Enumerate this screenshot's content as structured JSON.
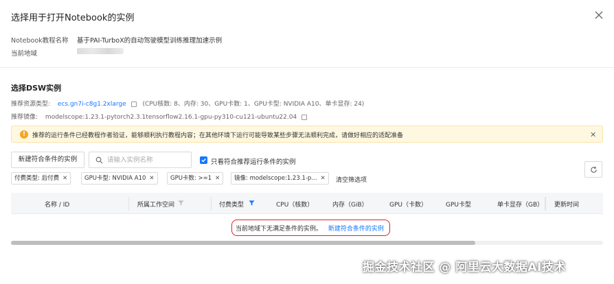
{
  "dialog": {
    "title": "选择用于打开Notebook的实例",
    "info": {
      "notebook_name_label": "Notebook教程名称",
      "notebook_name_value": "基于PAI-TurboX的自动驾驶模型训练推理加速示例",
      "region_label": "当前地域"
    }
  },
  "dsw": {
    "section_title": "选择DSW实例",
    "spec_label": "推荐资源类型:",
    "spec_value": "ecs.gn7i-c8g1.2xlarge",
    "spec_detail": "(CPU核数: 8、内存: 30、GPU卡数: 1、GPU卡型: NVIDIA A10、单卡显存: 24)",
    "image_label": "推荐镜像:",
    "image_value": "modelscope:1.23.1-pytorch2.3.1tensorflow2.16.1-gpu-py310-cu121-ubuntu22.04"
  },
  "alert": {
    "icon": "warning-icon",
    "text": "推荐的运行条件已经教程作者验证，能够顺利执行教程内容；在其他环境下运行可能导致某些步骤无法顺利完成，请做好相应的适配准备"
  },
  "toolbar": {
    "create_button": "新建符合条件的实例",
    "search_placeholder": "请输入实例名称",
    "only_matching_label": "只看符合推荐运行条件的实例",
    "only_matching_checked": true
  },
  "filters": {
    "tags": [
      "付费类型: 后付费",
      "GPU卡型: NVIDIA A10",
      "GPU卡数: >=1",
      "镜像: modelscope:1.23.1-p..."
    ],
    "clear_label": "清空筛选项"
  },
  "table": {
    "columns": [
      "名称 / ID",
      "所属工作空间",
      "付费类型",
      "CPU（核数）",
      "内存（GiB）",
      "GPU（卡数）",
      "GPU卡型",
      "单卡显存（GB）",
      "更新时间"
    ],
    "empty_text": "当前地域下无满足条件的实例。",
    "empty_link": "新建符合条件的实例"
  },
  "watermark": "掘金技术社区 @ 阿里云大数据AI技术",
  "colors": {
    "accent": "#1677ff",
    "alert_bg": "#fff8e1",
    "alert_icon": "#f5a623",
    "highlight": "#e02020"
  }
}
